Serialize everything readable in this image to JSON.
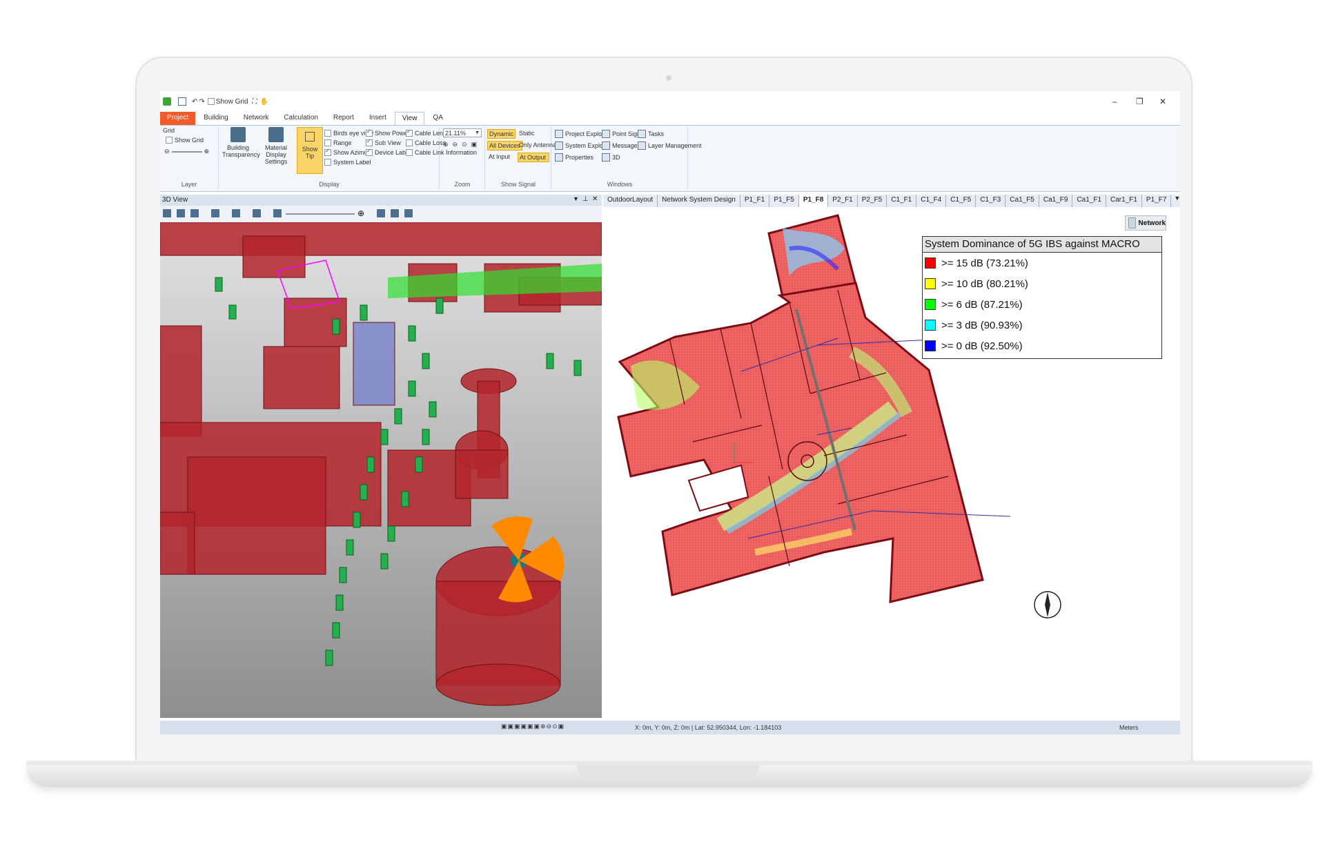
{
  "quick_access": {
    "show_grid_label": "Show Grid"
  },
  "tabs": [
    "Project",
    "Building",
    "Network",
    "Calculation",
    "Report",
    "Insert",
    "View",
    "QA"
  ],
  "ribbon": {
    "layer": {
      "title": "Grid",
      "show_grid": "Show Grid",
      "group_label": "Layer"
    },
    "display": {
      "building_transparency": "Building Transparency",
      "material_display": "Material Display Settings",
      "show_tip": "Show Tip",
      "col1": [
        "Birds eye view",
        "Range",
        "Show Azimuth",
        "System Label"
      ],
      "col2": [
        "Show Power",
        "Sub View",
        "Device Label"
      ],
      "col3": [
        "Cable Length",
        "Cable Loss",
        "Cable Link Information"
      ],
      "group_label": "Display"
    },
    "zoom": {
      "value": "21.11%",
      "group_label": "Zoom"
    },
    "show_signal": {
      "dynamic": "Dynamic",
      "static": "Static",
      "all_devices": "All Devices",
      "only_antenna": "Only Antenna",
      "at_input": "At Input",
      "at_output": "At Output",
      "group_label": "Show Signal"
    },
    "windows": {
      "items": [
        "Project Explorer",
        "Point Signal",
        "Tasks",
        "System Explorer",
        "Messages",
        "Layer Management",
        "Properties",
        "3D"
      ],
      "group_label": "Windows"
    }
  },
  "left_pane": {
    "title": "3D View"
  },
  "doc_tabs": [
    "OutdoorLayout",
    "Network System Design",
    "P1_F1",
    "P1_F5",
    "P1_F8",
    "P2_F1",
    "P2_F5",
    "C1_F1",
    "C1_F4",
    "C1_F5",
    "C1_F3",
    "Ca1_F5",
    "Ca1_F9",
    "Ca1_F1",
    "Car1_F1",
    "P1_F7"
  ],
  "active_doc_tab": "P1_F8",
  "network_button": "Network",
  "legend": {
    "title": "System Dominance of 5G IBS against MACRO",
    "items": [
      {
        "label": ">= 15 dB  (73.21%)",
        "color": "#ff0000"
      },
      {
        "label": ">= 10 dB  (80.21%)",
        "color": "#ffff00"
      },
      {
        "label": ">= 6 dB  (87.21%)",
        "color": "#00ff00"
      },
      {
        "label": ">= 3 dB  (90.93%)",
        "color": "#00ffff"
      },
      {
        "label": ">= 0 dB  (92.50%)",
        "color": "#0000ff"
      }
    ]
  },
  "status": {
    "coords": "X: 0m, Y: 0m, Z: 0m | Lat: 52.950344, Lon: -1.184103",
    "units": "Meters"
  },
  "colors": {
    "accent_orange": "#f15a29",
    "building_red": "#b3262b",
    "coverage_red": "#ee6464",
    "ribbon_bg": "#f3f6fa"
  }
}
